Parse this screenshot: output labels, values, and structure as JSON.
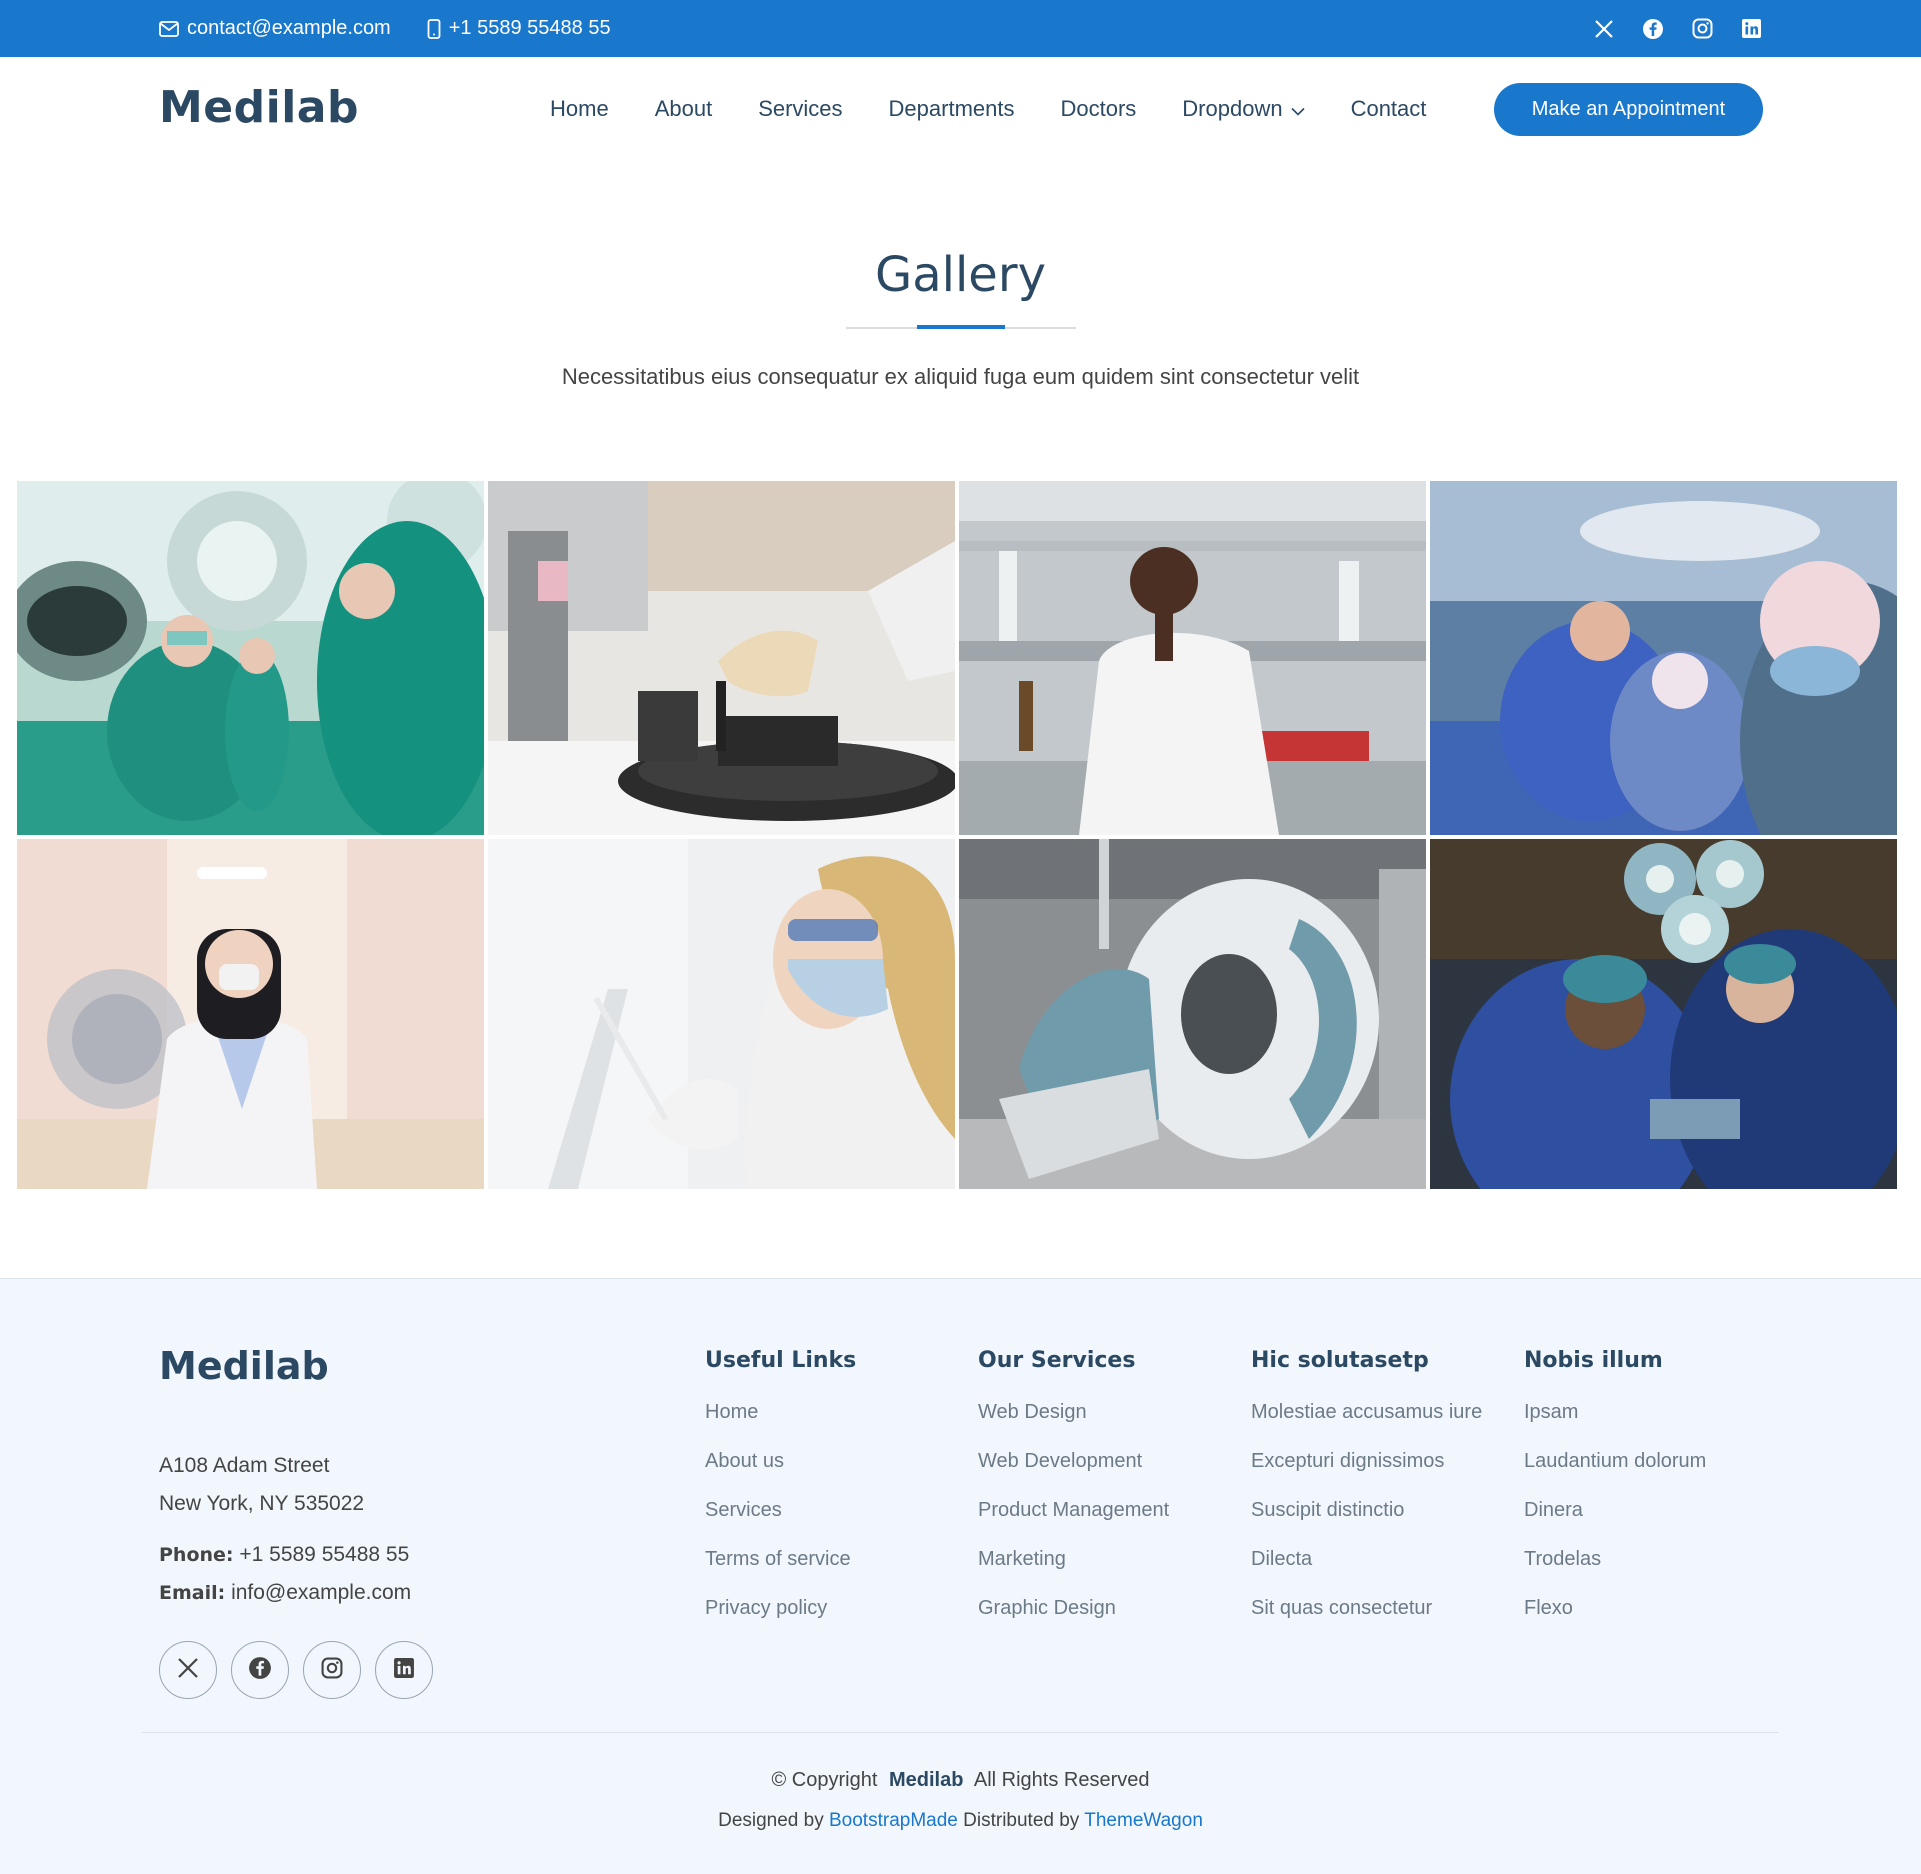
{
  "topbar": {
    "email": "contact@example.com",
    "phone": "+1 5589 55488 55",
    "icons": [
      "envelope-icon",
      "phone-icon",
      "x-twitter-icon",
      "facebook-icon",
      "instagram-icon",
      "linkedin-icon"
    ]
  },
  "header": {
    "logo": "Medilab",
    "nav": [
      "Home",
      "About",
      "Services",
      "Departments",
      "Doctors",
      "Dropdown",
      "Contact"
    ],
    "cta": "Make an Appointment"
  },
  "gallery": {
    "title": "Gallery",
    "subtitle": "Necessitatibus eius consequatur ex aliquid fuga eum quidem sint consectetur velit",
    "images": [
      "surgeons-operating-room",
      "lab-gloved-hand-test-tube",
      "lab-researcher-white-coat",
      "surgical-team-operating",
      "doctor-hospital-corridor",
      "researcher-safety-glasses",
      "mri-scanner",
      "surgeons-under-lights"
    ]
  },
  "footer": {
    "brand": "Medilab",
    "address_line1": "A108 Adam Street",
    "address_line2": "New York, NY 535022",
    "phone_label": "Phone:",
    "phone": "+1 5589 55488 55",
    "email_label": "Email:",
    "email": "info@example.com",
    "columns": [
      {
        "title": "Useful Links",
        "links": [
          "Home",
          "About us",
          "Services",
          "Terms of service",
          "Privacy policy"
        ]
      },
      {
        "title": "Our Services",
        "links": [
          "Web Design",
          "Web Development",
          "Product Management",
          "Marketing",
          "Graphic Design"
        ]
      },
      {
        "title": "Hic solutasetp",
        "links": [
          "Molestiae accusamus iure",
          "Excepturi dignissimos",
          "Suscipit distinctio",
          "Dilecta",
          "Sit quas consectetur"
        ]
      },
      {
        "title": "Nobis illum",
        "links": [
          "Ipsam",
          "Laudantium dolorum",
          "Dinera",
          "Trodelas",
          "Flexo"
        ]
      }
    ],
    "copyright_prefix": "© Copyright",
    "copyright_brand": "Medilab",
    "copyright_suffix": "All Rights Reserved",
    "designed_by_label": "Designed by",
    "designed_by": "BootstrapMade",
    "distributed_by_label": "Distributed by",
    "distributed_by": "ThemeWagon"
  },
  "colors": {
    "accent": "#1977cc",
    "heading": "#2c4964",
    "footer_bg": "#f1f7fc"
  }
}
